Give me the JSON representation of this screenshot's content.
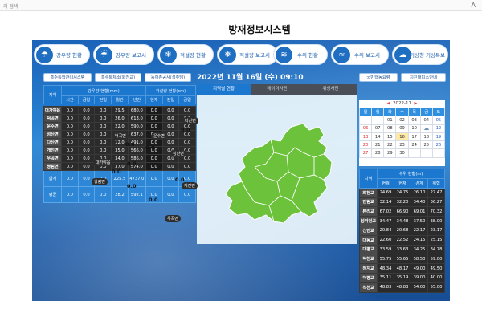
{
  "browser": {
    "address_text": "지 검색",
    "reader_icon": "A"
  },
  "page": {
    "title": "방재정보시스템"
  },
  "tabs": [
    {
      "label": "강우량 현황",
      "icon": "cloud-rain-icon",
      "glyph": "☂"
    },
    {
      "label": "강우량 보고서",
      "icon": "cloud-rain-report-icon",
      "glyph": "☔"
    },
    {
      "label": "적설량 현황",
      "icon": "snow-icon",
      "glyph": "❄"
    },
    {
      "label": "적설량 보고서",
      "icon": "snow-report-icon",
      "glyph": "❅"
    },
    {
      "label": "수위 현황",
      "icon": "water-level-icon",
      "glyph": "≋"
    },
    {
      "label": "수위 보고서",
      "icon": "water-report-icon",
      "glyph": "≈"
    },
    {
      "label": "기상청 기상특보",
      "icon": "weather-alert-icon",
      "glyph": "☁"
    }
  ],
  "left_buttons": [
    "홍수통합관리시스템",
    "홍수통제소(화천교)",
    "농어촌공사(성주댐)"
  ],
  "rain_table": {
    "header_region": "지역",
    "header_rain_group": "강우량 현황(mm)",
    "header_snow_group": "적설량 현황(cm)",
    "rain_columns": [
      "시간",
      "금일",
      "전일",
      "월간",
      "년간"
    ],
    "snow_columns": [
      "현재",
      "전일",
      "금일"
    ],
    "rows": [
      {
        "name": "대가야읍",
        "v": [
          "0.0",
          "0.0",
          "0.0",
          "29.5",
          "680.0",
          "0.0",
          "0.0",
          "0.0"
        ]
      },
      {
        "name": "덕곡면",
        "v": [
          "0.0",
          "0.0",
          "0.0",
          "26.0",
          "613.0",
          "0.0",
          "0.0",
          "0.0"
        ]
      },
      {
        "name": "운수면",
        "v": [
          "0.0",
          "0.0",
          "0.0",
          "22.0",
          "590.0",
          "0.0",
          "0.0",
          "0.0"
        ]
      },
      {
        "name": "성산면",
        "v": [
          "0.0",
          "0.0",
          "0.0",
          "30.0",
          "637.0",
          "0.0",
          "0.0",
          "0.0"
        ]
      },
      {
        "name": "다산면",
        "v": [
          "0.0",
          "0.0",
          "0.0",
          "12.0",
          "491.0",
          "0.0",
          "0.0",
          "0.0"
        ]
      },
      {
        "name": "개진면",
        "v": [
          "0.0",
          "0.0",
          "0.0",
          "35.0",
          "566.0",
          "0.0",
          "0.0",
          "0.0"
        ]
      },
      {
        "name": "우곡면",
        "v": [
          "0.0",
          "0.0",
          "0.0",
          "34.0",
          "586.0",
          "0.0",
          "0.0",
          "0.0"
        ]
      },
      {
        "name": "쌍림면",
        "v": [
          "0.0",
          "0.0",
          "0.0",
          "37.0",
          "574.0",
          "0.0",
          "0.0",
          "0.0"
        ]
      }
    ],
    "total_row": {
      "name": "합계",
      "v": [
        "0.0",
        "0.0",
        "0.0",
        "225.5",
        "4737.0",
        "0.0",
        "0.0",
        "0.0"
      ]
    },
    "avg_row": {
      "name": "평균",
      "v": [
        "0.0",
        "0.0",
        "0.0",
        "28.2",
        "592.1",
        "0.0",
        "0.0",
        "0.0"
      ]
    }
  },
  "datetime": "2022년 11월 16일 (수) 09:10",
  "map_tabs": [
    {
      "label": "지역별 현황",
      "active": true
    },
    {
      "label": "레이더사진",
      "active": false
    },
    {
      "label": "위성사진",
      "active": false
    }
  ],
  "map": {
    "fill_color": "#6cc23a",
    "regions": [
      {
        "name": "다산면",
        "value": "0.0"
      },
      {
        "name": "덕곡면",
        "value": "0.0"
      },
      {
        "name": "운수면",
        "value": "0.0"
      },
      {
        "name": "성산면",
        "value": "0.0"
      },
      {
        "name": "대가야읍",
        "value": "0.0"
      },
      {
        "name": "쌍림면",
        "value": "0.0"
      },
      {
        "name": "개진면",
        "value": "0.0"
      },
      {
        "name": "우곡면",
        "value": "0.0"
      }
    ],
    "extra_values": [
      "0.0",
      "0.0"
    ]
  },
  "right_buttons": [
    "국민행동요령",
    "지진대피소안내"
  ],
  "calendar": {
    "month_label": "2022-11",
    "prev_icon": "◀",
    "next_icon": "▶",
    "weekdays": [
      "일",
      "월",
      "화",
      "수",
      "목",
      "금",
      "토"
    ],
    "weeks": [
      [
        "",
        "",
        "01",
        "02",
        "03",
        "04",
        "05"
      ],
      [
        "06",
        "07",
        "08",
        "09",
        "10",
        "☁",
        "12"
      ],
      [
        "13",
        "14",
        "15",
        "16",
        "17",
        "18",
        "19"
      ],
      [
        "20",
        "21",
        "22",
        "23",
        "24",
        "25",
        "26"
      ],
      [
        "27",
        "28",
        "29",
        "30",
        "",
        "",
        ""
      ]
    ]
  },
  "water_table": {
    "header_region": "지역",
    "header_group": "수위 현황(m)",
    "columns": [
      "현월",
      "현재",
      "경계",
      "위험"
    ],
    "rows": [
      {
        "name": "화천교",
        "v": [
          "24.69",
          "24.75",
          "26.10",
          "27.47"
        ]
      },
      {
        "name": "안림교",
        "v": [
          "32.14",
          "32.20",
          "34.40",
          "36.27"
        ]
      },
      {
        "name": "본리교",
        "v": [
          "67.02",
          "66.90",
          "69.01",
          "70.32"
        ]
      },
      {
        "name": "성하천교",
        "v": [
          "34.47",
          "34.48",
          "37.50",
          "38.00"
        ]
      },
      {
        "name": "신안교",
        "v": [
          "20.84",
          "20.68",
          "22.17",
          "23.17"
        ]
      },
      {
        "name": "대동교",
        "v": [
          "22.60",
          "22.52",
          "24.15",
          "25.15"
        ]
      },
      {
        "name": "대평교",
        "v": [
          "33.59",
          "33.63",
          "34.25",
          "34.78"
        ]
      },
      {
        "name": "덕천교",
        "v": [
          "55.75",
          "55.65",
          "58.50",
          "59.00"
        ]
      },
      {
        "name": "정지교",
        "v": [
          "48.34",
          "48.17",
          "49.00",
          "49.50"
        ]
      },
      {
        "name": "덕평교",
        "v": [
          "35.11",
          "35.19",
          "39.00",
          "40.00"
        ]
      },
      {
        "name": "직천교",
        "v": [
          "48.83",
          "48.83",
          "54.00",
          "55.00"
        ]
      }
    ]
  }
}
